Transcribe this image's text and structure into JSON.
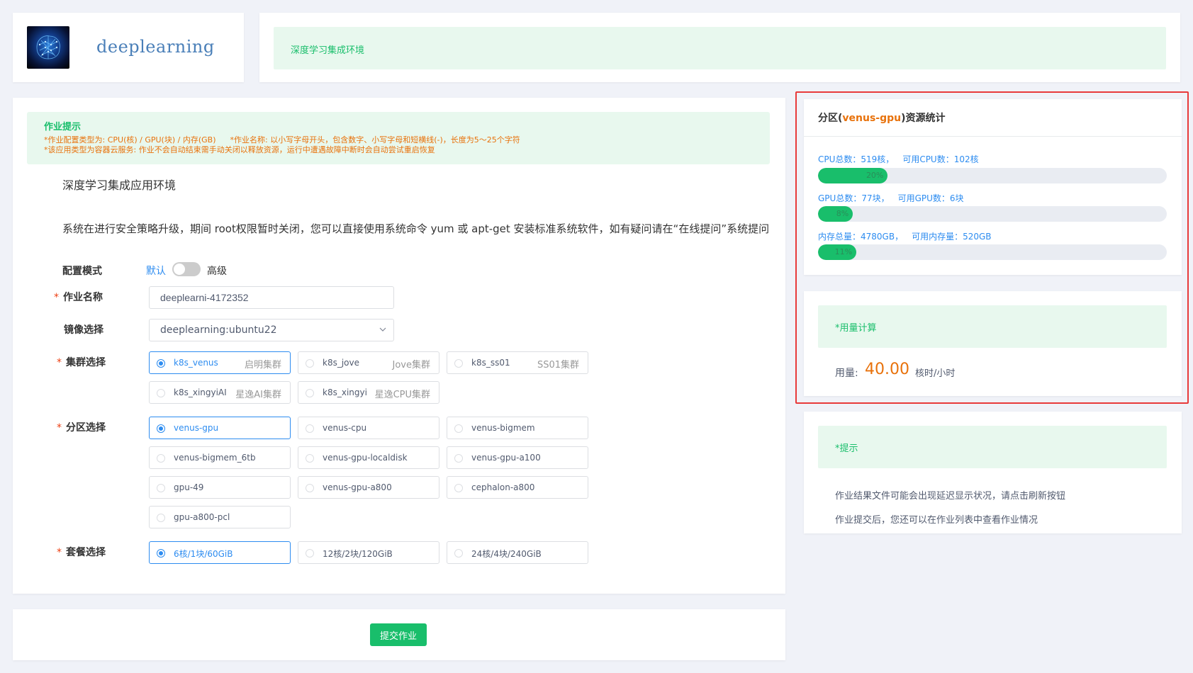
{
  "header": {
    "app_name": "deeplearning",
    "banner_text": "深度学习集成环境"
  },
  "tips": {
    "title": "作业提示",
    "line1_a": "*作业配置类型为: CPU(核) / GPU(块) / 内存(GB)",
    "line1_b": "*作业名称: 以小写字母开头，包含数字、小写字母和短横线(-)，长度为5～25个字符",
    "line2": "*该应用类型为容器云服务: 作业不会自动结束需手动关闭以释放资源，运行中遭遇故障中断时会自动尝试重启恢复"
  },
  "form": {
    "app_title": "深度学习集成应用环境",
    "notice": "系统在进行安全策略升级，期间 root权限暂时关闭，您可以直接使用系统命令 yum 或 apt-get 安装标准系统软件，如有疑问请在“在线提问”系统提问",
    "mode": {
      "label": "配置模式",
      "default": "默认",
      "advanced": "高级"
    },
    "job_name": {
      "label": "作业名称",
      "value": "deeplearni-4172352"
    },
    "image": {
      "label": "镜像选择",
      "value": "deeplearning:ubuntu22"
    },
    "cluster": {
      "label": "集群选择",
      "options": [
        {
          "name": "k8s_venus",
          "desc": "启明集群",
          "selected": true
        },
        {
          "name": "k8s_jove",
          "desc": "Jove集群",
          "selected": false
        },
        {
          "name": "k8s_ss01",
          "desc": "SS01集群",
          "selected": false
        },
        {
          "name": "k8s_xingyiAI",
          "desc": "星逸AI集群",
          "selected": false
        },
        {
          "name": "k8s_xingyi",
          "desc": "星逸CPU集群",
          "selected": false
        }
      ]
    },
    "partition": {
      "label": "分区选择",
      "options": [
        {
          "name": "venus-gpu",
          "selected": true
        },
        {
          "name": "venus-cpu",
          "selected": false
        },
        {
          "name": "venus-bigmem",
          "selected": false
        },
        {
          "name": "venus-bigmem_6tb",
          "selected": false
        },
        {
          "name": "venus-gpu-localdisk",
          "selected": false
        },
        {
          "name": "venus-gpu-a100",
          "selected": false
        },
        {
          "name": "gpu-49",
          "selected": false
        },
        {
          "name": "venus-gpu-a800",
          "selected": false
        },
        {
          "name": "cephalon-a800",
          "selected": false
        },
        {
          "name": "gpu-a800-pcl",
          "selected": false
        }
      ]
    },
    "package": {
      "label": "套餐选择",
      "options": [
        {
          "name": "6核/1块/60GiB",
          "selected": true
        },
        {
          "name": "12核/2块/120GiB",
          "selected": false
        },
        {
          "name": "24核/4块/240GiB",
          "selected": false
        }
      ]
    },
    "submit_label": "提交作业"
  },
  "stats": {
    "title_prefix": "分区(",
    "partition": "venus-gpu",
    "title_suffix": ")资源统计",
    "rows": [
      {
        "total": "CPU总数：519核，",
        "avail": "可用CPU数：102核",
        "percent": 20,
        "percent_label": "20%"
      },
      {
        "total": "GPU总数：77块，",
        "avail": "可用GPU数：6块",
        "percent": 8,
        "percent_label": "8%"
      },
      {
        "total": "内存总量：4780GB，",
        "avail": "可用内存量：520GB",
        "percent": 11,
        "percent_label": "11%"
      }
    ]
  },
  "usage": {
    "box_title": "*用量计算",
    "label": "用量:",
    "value": "40.00",
    "unit": "核时/小时"
  },
  "hint": {
    "box_title": "*提示",
    "lines": [
      "作业结果文件可能会出现延迟显示状况，请点击刷新按钮",
      "作业提交后，您还可以在作业列表中查看作业情况"
    ]
  },
  "colors": {
    "accent_green": "#19be6b",
    "accent_blue": "#2d8cf0",
    "accent_orange": "#e8720c",
    "highlight_red": "#e83a3a"
  }
}
